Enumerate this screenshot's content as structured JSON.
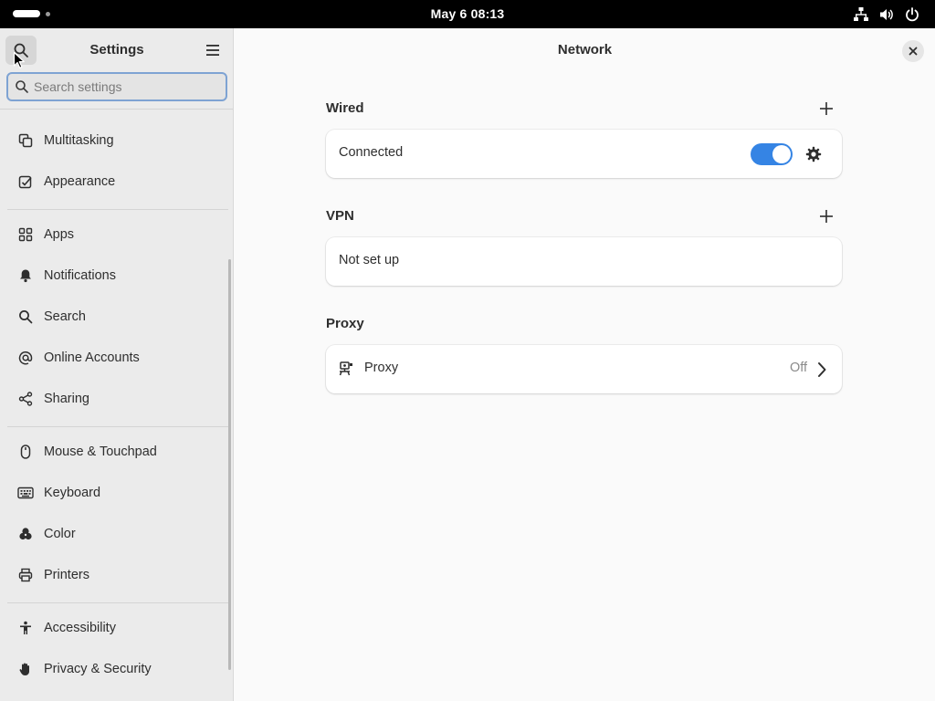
{
  "topbar": {
    "clock": "May 6  08:13",
    "icons": [
      "activities-indicator",
      "network-icon",
      "volume-icon",
      "power-icon"
    ]
  },
  "sidebar": {
    "title": "Settings",
    "search_placeholder": "Search settings",
    "groups": [
      [
        {
          "label": "Multitasking",
          "icon": "multitasking-icon"
        },
        {
          "label": "Appearance",
          "icon": "appearance-icon"
        }
      ],
      [
        {
          "label": "Apps",
          "icon": "apps-icon"
        },
        {
          "label": "Notifications",
          "icon": "bell-icon"
        },
        {
          "label": "Search",
          "icon": "search-icon"
        },
        {
          "label": "Online Accounts",
          "icon": "at-icon"
        },
        {
          "label": "Sharing",
          "icon": "share-icon"
        }
      ],
      [
        {
          "label": "Mouse & Touchpad",
          "icon": "mouse-icon"
        },
        {
          "label": "Keyboard",
          "icon": "keyboard-icon"
        },
        {
          "label": "Color",
          "icon": "color-icon"
        },
        {
          "label": "Printers",
          "icon": "printer-icon"
        }
      ],
      [
        {
          "label": "Accessibility",
          "icon": "accessibility-icon"
        },
        {
          "label": "Privacy & Security",
          "icon": "hand-icon"
        }
      ]
    ]
  },
  "main": {
    "title": "Network",
    "wired": {
      "title": "Wired",
      "status": "Connected",
      "enabled": true
    },
    "vpn": {
      "title": "VPN",
      "status": "Not set up"
    },
    "proxy": {
      "title": "Proxy",
      "label": "Proxy",
      "status": "Off"
    }
  },
  "colors": {
    "accent": "#3584e4",
    "topbar": "#000000",
    "sidebar": "#ebebeb",
    "content": "#fafafa"
  }
}
